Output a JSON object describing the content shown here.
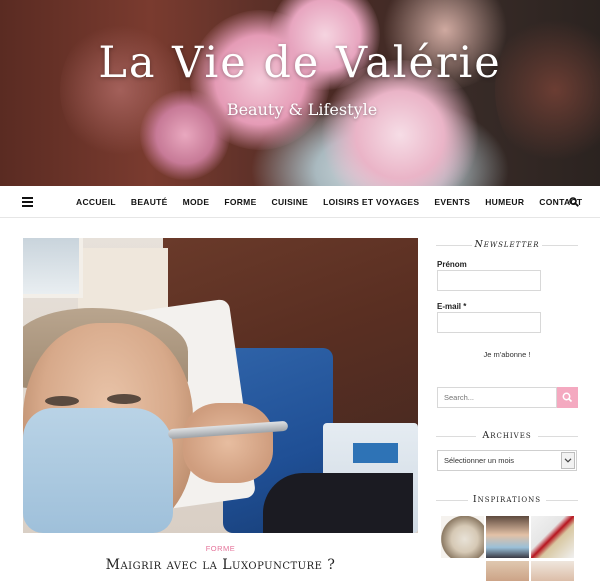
{
  "header": {
    "site_title": "La Vie de Valérie",
    "tagline": "Beauty & Lifestyle"
  },
  "nav": {
    "items": [
      "ACCUEIL",
      "BEAUTÉ",
      "MODE",
      "FORME",
      "CUISINE",
      "LOISIRS ET VOYAGES",
      "EVENTS",
      "HUMEUR",
      "CONTACT"
    ],
    "menu_icon": "hamburger-icon",
    "search_icon": "search-icon"
  },
  "post": {
    "category": "FORME",
    "title": "Maigrir avec la Luxopuncture ?"
  },
  "sidebar": {
    "newsletter": {
      "title": "Newsletter",
      "firstname_label": "Prénom",
      "email_label": "E-mail *",
      "submit_label": "Je m'abonne !"
    },
    "search": {
      "placeholder": "Search..."
    },
    "archives": {
      "title": "Archives",
      "selected": "Sélectionner un mois"
    },
    "inspirations": {
      "title": "Inspirations"
    }
  },
  "colors": {
    "accent_pink": "#f4a9c0",
    "category_pink": "#e5739a"
  }
}
